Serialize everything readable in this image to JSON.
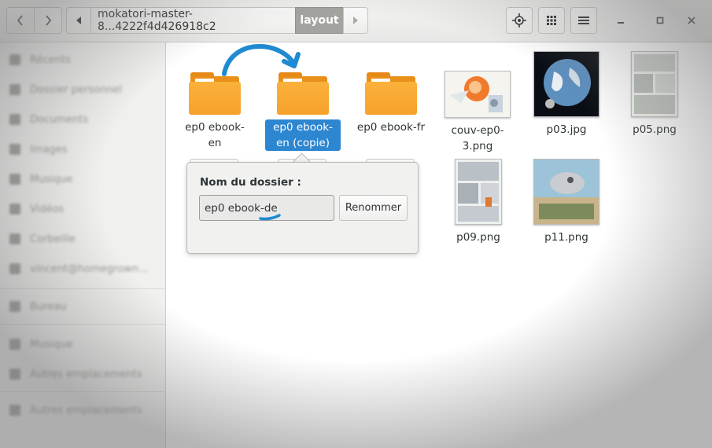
{
  "header": {
    "path_segment_1": "mokatori-master-8...4222f4d426918c2",
    "path_segment_2": "layout",
    "icons": {
      "back": "chevron-left-icon",
      "forward": "chevron-right-icon",
      "path_left": "triangle-left-icon",
      "path_right": "triangle-right-icon",
      "locate": "crosshair-icon",
      "grid": "grid-view-icon",
      "menu": "hamburger-menu-icon",
      "minimize": "minimize-icon",
      "maximize": "maximize-icon",
      "close": "close-icon"
    }
  },
  "sidebar": {
    "items": [
      {
        "label": "Récents"
      },
      {
        "label": "Dossier personnel"
      },
      {
        "label": "Documents"
      },
      {
        "label": "Images"
      },
      {
        "label": "Musique"
      },
      {
        "label": "Vidéos"
      },
      {
        "label": "Corbeille"
      },
      {
        "label": "vincent@homegrown..."
      },
      {
        "label": "Bureau"
      },
      {
        "label": "Musique"
      },
      {
        "label": "Autres emplacements"
      }
    ]
  },
  "files": [
    {
      "name": "ep0 ebook-en",
      "type": "folder"
    },
    {
      "name": "ep0 ebook-en (copie)",
      "type": "folder",
      "selected": true
    },
    {
      "name": "ep0 ebook-fr",
      "type": "folder"
    },
    {
      "name": "couv-ep0-3.png",
      "type": "image"
    },
    {
      "name": "p03.jpg",
      "type": "image"
    },
    {
      "name": "p05.png",
      "type": "image"
    },
    {
      "name": "p09.png",
      "type": "image"
    },
    {
      "name": "p11.png",
      "type": "image"
    }
  ],
  "rename_popover": {
    "title": "Nom du dossier :",
    "input_value": "ep0 ebook-de",
    "button_label": "Renommer"
  },
  "colors": {
    "selection": "#2d86d0",
    "folder": "#f6a22b",
    "annotation": "#1f8ad1"
  }
}
